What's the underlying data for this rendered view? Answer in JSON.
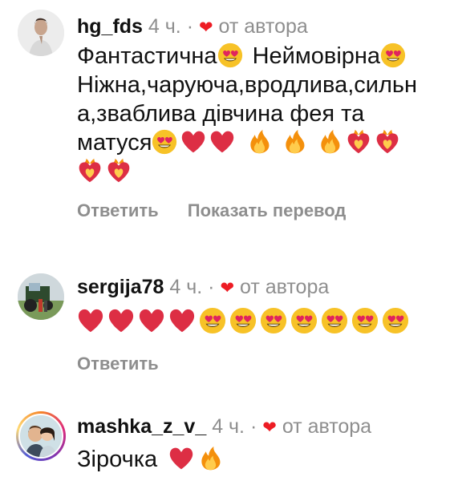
{
  "comments": [
    {
      "username": "hg_fds",
      "time": "4 ч.",
      "separator": "·",
      "heart": "❤",
      "author_label": "от автора",
      "text_lines": [
        "Фантастична",
        "Неймовірна",
        "Ніжна,чаруюча,вродлива,сильн",
        "а,зваблива дівчина фея та",
        "матуся"
      ],
      "actions": [
        "Ответить",
        "Показать перевод"
      ]
    },
    {
      "username": "sergija78",
      "time": "4 ч.",
      "separator": "·",
      "heart": "❤",
      "author_label": "от автора",
      "actions": [
        "Ответить"
      ]
    },
    {
      "username": "mashka_z_v_",
      "time": "4 ч.",
      "separator": "·",
      "heart": "❤",
      "author_label": "от автора",
      "text": "Зірочка"
    }
  ],
  "colors": {
    "heart": "#ed1c24",
    "muted": "#8e8e8e",
    "text": "#111111",
    "emoji_yellow": "#f7c227",
    "fire_orange": "#f4900c"
  },
  "emoji_names": [
    "heart-eyes-emoji",
    "red-heart-emoji",
    "fire-emoji",
    "heart-on-fire-emoji"
  ]
}
